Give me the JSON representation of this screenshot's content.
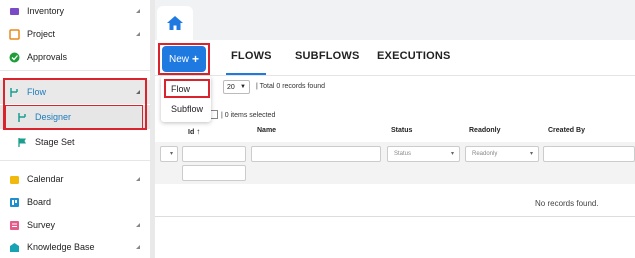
{
  "sidebar": {
    "items": [
      {
        "label": "Inventory",
        "icon": "inventory-icon"
      },
      {
        "label": "Project",
        "icon": "project-icon"
      },
      {
        "label": "Approvals",
        "icon": "approvals-icon"
      },
      {
        "label": "Flow",
        "icon": "flow-icon"
      },
      {
        "label": "Designer",
        "icon": "designer-icon"
      },
      {
        "label": "Stage Set",
        "icon": "flag-icon"
      },
      {
        "label": "Calendar",
        "icon": "calendar-icon"
      },
      {
        "label": "Board",
        "icon": "board-icon"
      },
      {
        "label": "Survey",
        "icon": "survey-icon"
      },
      {
        "label": "Knowledge Base",
        "icon": "knowledge-base-icon"
      }
    ]
  },
  "toolbar": {
    "new_label": "New",
    "tabs": [
      "FLOWS",
      "SUBFLOWS",
      "EXECUTIONS"
    ]
  },
  "new_menu": {
    "items": [
      "Flow",
      "Subflow"
    ]
  },
  "pagination": {
    "page_size": "20",
    "records_text": "| Total 0 records found"
  },
  "selection": {
    "text": "| 0 items selected"
  },
  "table": {
    "columns": [
      "Id",
      "Name",
      "Status",
      "Readonly",
      "Created By"
    ],
    "status_placeholder": "Status",
    "readonly_placeholder": "Readonly",
    "empty_text": "No records found."
  },
  "colors": {
    "accent": "#1e7ae0",
    "highlight": "#d9232d"
  }
}
